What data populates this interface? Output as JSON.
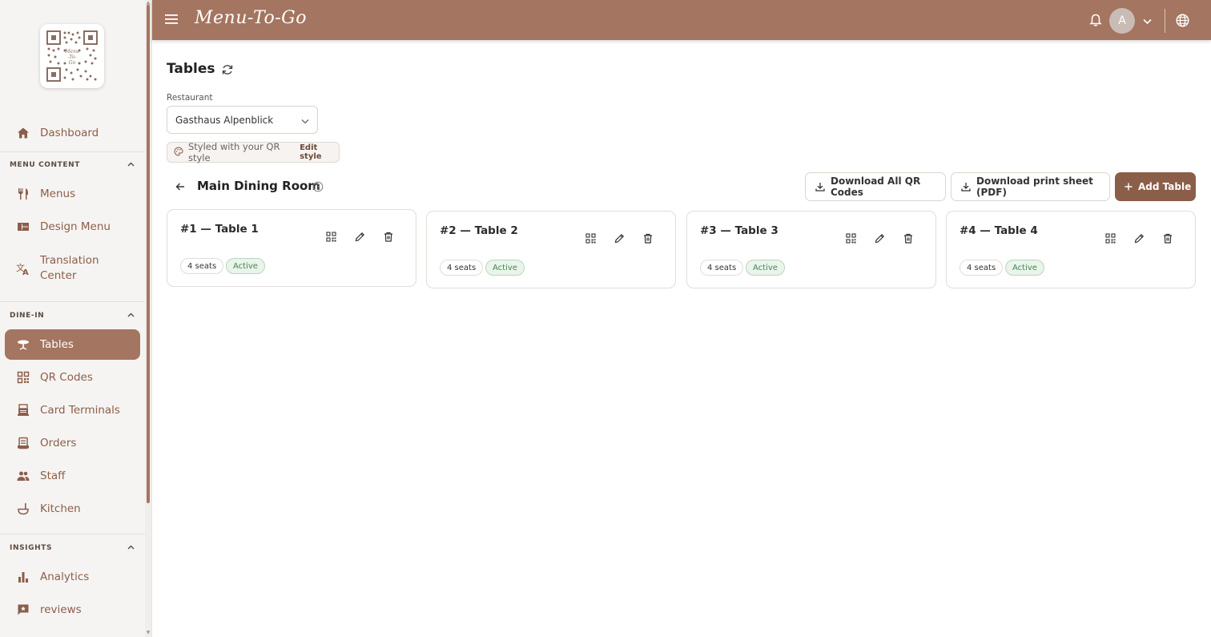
{
  "app": {
    "brand": "Menu-To-Go"
  },
  "topbar": {
    "avatar_initial": "A"
  },
  "sidebar": {
    "items": {
      "dashboard": "Dashboard",
      "menus": "Menus",
      "design_menu": "Design Menu",
      "translation_center_line1": "Translation",
      "translation_center_line2": "Center",
      "tables": "Tables",
      "qr_codes": "QR Codes",
      "card_terminals": "Card Terminals",
      "orders": "Orders",
      "staff": "Staff",
      "kitchen": "Kitchen",
      "analytics": "Analytics",
      "reviews": "reviews"
    },
    "sections": {
      "menu_content": "MENU CONTENT",
      "dine_in": "DINE-IN",
      "insights": "INSIGHTS"
    },
    "active": "tables"
  },
  "page": {
    "title": "Tables",
    "restaurant_label": "Restaurant",
    "restaurant_value": "Gasthaus Alpenblick",
    "style_note": "Styled with your QR style",
    "edit_style": "Edit style"
  },
  "room": {
    "title": "Main Dining Room",
    "download_all": "Download All QR Codes",
    "download_sheet": "Download print sheet (PDF)",
    "add_table": "Add Table"
  },
  "tables": [
    {
      "title": "#1 — Table 1",
      "seats": "4 seats",
      "status": "Active"
    },
    {
      "title": "#2 — Table 2",
      "seats": "4 seats",
      "status": "Active"
    },
    {
      "title": "#3 — Table 3",
      "seats": "4 seats",
      "status": "Active"
    },
    {
      "title": "#4 — Table 4",
      "seats": "4 seats",
      "status": "Active"
    }
  ],
  "colors": {
    "brand": "#a47560",
    "brand_dark": "#8b5e4a",
    "active_green": "#3f8a4e"
  }
}
